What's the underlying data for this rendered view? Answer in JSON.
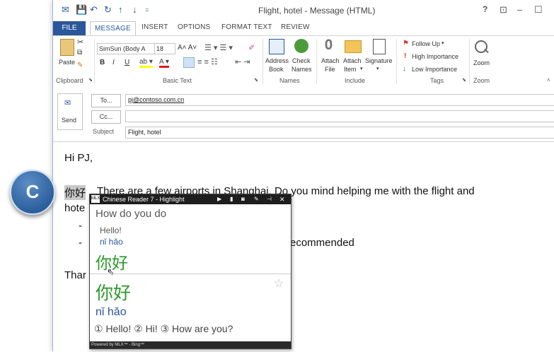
{
  "window": {
    "title": "Flight, hotel - Message (HTML)",
    "controls": {
      "help": "?",
      "restore": "⊡",
      "minimize": "–",
      "maximize": "☐"
    }
  },
  "tabs": [
    "FILE",
    "MESSAGE",
    "INSERT",
    "OPTIONS",
    "FORMAT TEXT",
    "REVIEW"
  ],
  "ribbon": {
    "clipboard": {
      "paste": "Paste",
      "label": "Clipboard"
    },
    "basic_text": {
      "font": "SimSun (Body A",
      "size": "18",
      "label": "Basic Text",
      "bold": "B",
      "italic": "I",
      "underline": "U"
    },
    "names": {
      "address_book_1": "Address",
      "address_book_2": "Book",
      "check_names_1": "Check",
      "check_names_2": "Names",
      "label": "Names"
    },
    "include": {
      "attach_file_1": "Attach",
      "attach_file_2": "File",
      "attach_item_1": "Attach",
      "attach_item_2": "Item",
      "signature": "Signature",
      "label": "Include"
    },
    "tags": {
      "follow_up": "Follow Up",
      "high": "High Importance",
      "low": "Low Importance",
      "label": "Tags"
    },
    "zoom": {
      "zoom": "Zoom",
      "label": "Zoom"
    }
  },
  "header": {
    "send": "Send",
    "to_label": "To...",
    "to_value": "pj@contoso.com.cn",
    "cc_label": "Cc...",
    "cc_value": "",
    "subject_label": "Subject",
    "subject_value": "Flight, hotel"
  },
  "body": {
    "greeting": "Hi PJ,",
    "highlight_word": "你好",
    "line1_rest": "There are a few airports in Shanghai. Do you mind helping me with the flight and",
    "line2_start": "hote",
    "bullet": "-",
    "line4_end": "ecommended",
    "thanks_start": "Thar"
  },
  "overlay_badge": "C",
  "popup": {
    "title": "Chinese Reader 7 - Highlight",
    "phrase_en": "How do you do",
    "alt_en": "Hello!",
    "pinyin_small": "nǐ hǎo",
    "chars_small": "你好",
    "chars_large": "你好",
    "pinyin_large": "nǐ hǎo",
    "definitions": "① Hello! ② Hi! ③ How are you?",
    "footer": "Powered by MLX™ - Bing™"
  }
}
